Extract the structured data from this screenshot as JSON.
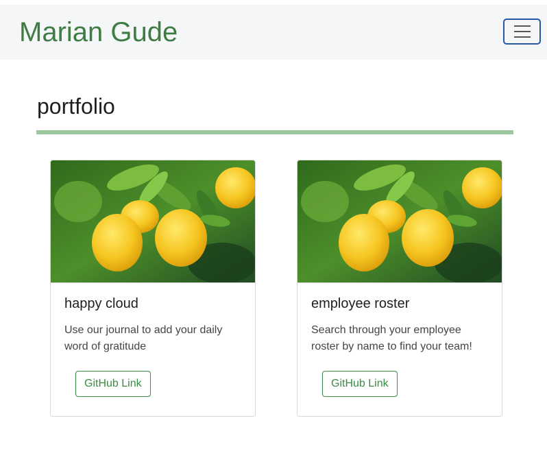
{
  "navbar": {
    "brand": "Marian Gude",
    "toggler_icon": "hamburger-menu-icon"
  },
  "section": {
    "title": "portfolio"
  },
  "cards": [
    {
      "image_alt": "lemons on tree",
      "title": "happy cloud",
      "text": "Use our journal to add your daily word of gratitude",
      "button_label": "GitHub Link"
    },
    {
      "image_alt": "lemons on tree",
      "title": "employee roster",
      "text": "Search through your employee roster by name to find your team!",
      "button_label": "GitHub Link"
    }
  ],
  "colors": {
    "brand": "#3f7c44",
    "navbar_bg": "#f5f6f8",
    "divider": "#9bc79d",
    "button": "#3a8b3f",
    "toggler_border": "#2557a7"
  }
}
